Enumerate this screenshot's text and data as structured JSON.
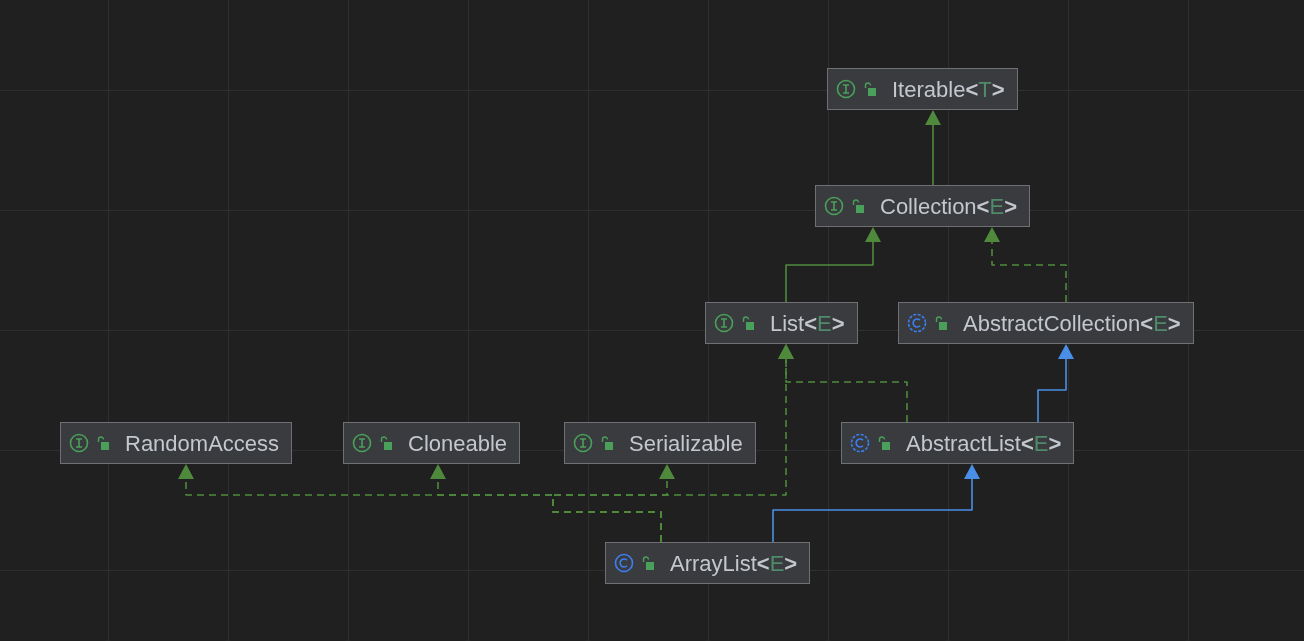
{
  "diagram": {
    "nodes": [
      {
        "kind": "interface",
        "name": "Iterable",
        "type_open": "<",
        "type_param": "T",
        "type_close": ">"
      },
      {
        "kind": "interface",
        "name": "Collection",
        "type_open": "<",
        "type_param": "E",
        "type_close": ">"
      },
      {
        "kind": "interface",
        "name": "List",
        "type_open": "<",
        "type_param": "E",
        "type_close": ">"
      },
      {
        "kind": "abstract-class",
        "name": "AbstractCollection",
        "type_open": "<",
        "type_param": "E",
        "type_close": ">"
      },
      {
        "kind": "interface",
        "name": "RandomAccess"
      },
      {
        "kind": "interface",
        "name": "Cloneable"
      },
      {
        "kind": "interface",
        "name": "Serializable"
      },
      {
        "kind": "abstract-class",
        "name": "AbstractList",
        "type_open": "<",
        "type_param": "E",
        "type_close": ">"
      },
      {
        "kind": "class",
        "name": "ArrayList",
        "type_open": "<",
        "type_param": "E",
        "type_close": ">"
      }
    ],
    "edges": [
      {
        "kind": "interface-extends"
      },
      {
        "kind": "interface-extends"
      },
      {
        "kind": "implements"
      },
      {
        "kind": "implements"
      },
      {
        "kind": "class-extends"
      },
      {
        "kind": "class-extends"
      },
      {
        "kind": "implements"
      },
      {
        "kind": "implements"
      },
      {
        "kind": "implements"
      },
      {
        "kind": "implements"
      }
    ]
  }
}
